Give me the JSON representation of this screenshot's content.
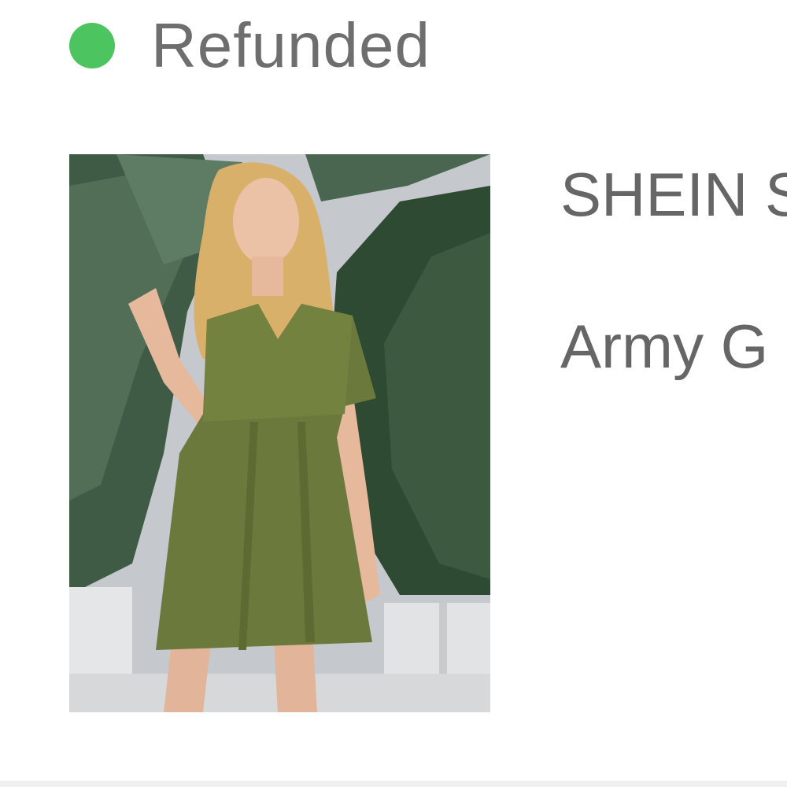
{
  "order_item": {
    "status": {
      "label": "Refunded",
      "color": "#4cc460"
    },
    "product": {
      "image_icon": "product-photo",
      "name": "SHEIN S",
      "variant": "Army G"
    }
  },
  "colors": {
    "text": "#666666",
    "status_green": "#4cc460",
    "dress_green": "#6b7a3c"
  }
}
